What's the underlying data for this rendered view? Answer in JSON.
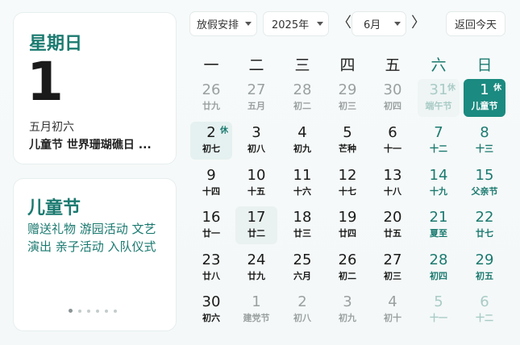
{
  "today_card": {
    "weekday": "星期日",
    "day": "1",
    "lunar": "五月初六",
    "holidays": "儿童节 世界珊瑚礁日 ..."
  },
  "festival_card": {
    "title": "儿童节",
    "description": "赠送礼物 游园活动 文艺演出 亲子活动 入队仪式",
    "page_dots": 6,
    "active_dot": 0
  },
  "toolbar": {
    "holiday_label": "放假安排",
    "year_label": "2025年",
    "month_label": "6月",
    "today_label": "返回今天",
    "prev_symbol": "〈",
    "next_symbol": "〉"
  },
  "weekdays": [
    "一",
    "二",
    "三",
    "四",
    "五",
    "六",
    "日"
  ],
  "calendar": [
    [
      {
        "d": "26",
        "l": "廿九",
        "other": true
      },
      {
        "d": "27",
        "l": "五月",
        "other": true
      },
      {
        "d": "28",
        "l": "初二",
        "other": true
      },
      {
        "d": "29",
        "l": "初三",
        "other": true
      },
      {
        "d": "30",
        "l": "初四",
        "other": true
      },
      {
        "d": "31",
        "l": "端午节",
        "other": true,
        "tag": "休",
        "state": "rest-faint"
      },
      {
        "d": "1",
        "l": "儿童节",
        "tag": "休",
        "state": "selected"
      }
    ],
    [
      {
        "d": "2",
        "l": "初七",
        "tag": "休",
        "state": "rest"
      },
      {
        "d": "3",
        "l": "初八"
      },
      {
        "d": "4",
        "l": "初九"
      },
      {
        "d": "5",
        "l": "芒种"
      },
      {
        "d": "6",
        "l": "十一"
      },
      {
        "d": "7",
        "l": "十二"
      },
      {
        "d": "8",
        "l": "十三"
      }
    ],
    [
      {
        "d": "9",
        "l": "十四"
      },
      {
        "d": "10",
        "l": "十五"
      },
      {
        "d": "11",
        "l": "十六"
      },
      {
        "d": "12",
        "l": "十七"
      },
      {
        "d": "13",
        "l": "十八"
      },
      {
        "d": "14",
        "l": "十九"
      },
      {
        "d": "15",
        "l": "父亲节"
      }
    ],
    [
      {
        "d": "16",
        "l": "廿一"
      },
      {
        "d": "17",
        "l": "廿二",
        "state": "hover"
      },
      {
        "d": "18",
        "l": "廿三"
      },
      {
        "d": "19",
        "l": "廿四"
      },
      {
        "d": "20",
        "l": "廿五"
      },
      {
        "d": "21",
        "l": "夏至"
      },
      {
        "d": "22",
        "l": "廿七"
      }
    ],
    [
      {
        "d": "23",
        "l": "廿八"
      },
      {
        "d": "24",
        "l": "廿九"
      },
      {
        "d": "25",
        "l": "六月"
      },
      {
        "d": "26",
        "l": "初二"
      },
      {
        "d": "27",
        "l": "初三"
      },
      {
        "d": "28",
        "l": "初四"
      },
      {
        "d": "29",
        "l": "初五"
      }
    ],
    [
      {
        "d": "30",
        "l": "初六"
      },
      {
        "d": "1",
        "l": "建党节",
        "other": true
      },
      {
        "d": "2",
        "l": "初八",
        "other": true
      },
      {
        "d": "3",
        "l": "初九",
        "other": true
      },
      {
        "d": "4",
        "l": "初十",
        "other": true
      },
      {
        "d": "5",
        "l": "十一",
        "other": true
      },
      {
        "d": "6",
        "l": "十二",
        "other": true
      }
    ]
  ],
  "colors": {
    "accent": "#1b7a70",
    "selected_bg": "#1b8a80",
    "rest_bg": "#e5f1f0",
    "muted": "#9aa0a0"
  }
}
